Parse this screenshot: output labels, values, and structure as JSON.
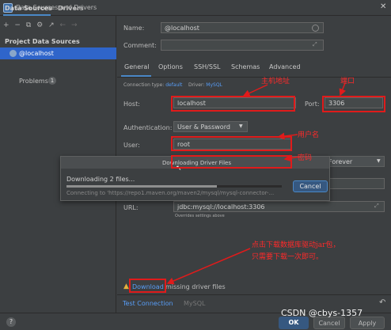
{
  "window": {
    "title": "Data Sources and Drivers",
    "close": "✕"
  },
  "left": {
    "tabs": [
      "Data Sources",
      "Drivers"
    ],
    "toolbar": {
      "add": "+",
      "remove": "−",
      "copy": "⧉",
      "settings": "⚙",
      "more": "↗",
      "back": "←",
      "forward": "→"
    },
    "section_header": "Project Data Sources",
    "items": [
      {
        "label": "@localhost",
        "selected": true
      }
    ],
    "problems": {
      "label": "Problems",
      "count": "1"
    }
  },
  "form": {
    "name_label": "Name:",
    "name_value": "@localhost",
    "comment_label": "Comment:",
    "comment_expand": "⤢",
    "tabs": [
      "General",
      "Options",
      "SSH/SSL",
      "Schemas",
      "Advanced"
    ],
    "active_tab": "General",
    "conn_type_label": "Connection type:",
    "conn_type_value": "default",
    "driver_label": "Driver:",
    "driver_value": "MySQL",
    "host_label": "Host:",
    "host_value": "localhost",
    "port_label": "Port:",
    "port_value": "3306",
    "auth_label": "Authentication:",
    "auth_value": "User & Password",
    "user_label": "User:",
    "user_value": "root",
    "save_value": "Forever",
    "url_label": "URL:",
    "url_value": "jdbc:mysql://localhost:3306",
    "url_note": "Overrides settings above",
    "missing_driver_prefix": "Download",
    "missing_driver_rest": "missing driver files",
    "test_connection": "Test Connection",
    "driver_footer": "MySQL",
    "undo_icon": "↶"
  },
  "modal": {
    "title": "Downloading Driver Files",
    "status": "Downloading 2 files...",
    "progress_fraction": 0.7,
    "url_text": "Connecting to 'https://repo1.maven.org/maven2/mysql/mysql-connector-...",
    "cancel": "Cancel"
  },
  "annotations": {
    "host": "主机地址",
    "port": "端口",
    "user": "用户名",
    "password": "密码",
    "download_line1": "点击下载数据库驱动jar包，",
    "download_line2": "只需要下载一次即可。"
  },
  "footer": {
    "help": "?",
    "ok": "OK",
    "cancel": "Cancel",
    "apply": "Apply"
  },
  "watermark": "CSDN @cbys-1357",
  "colors": {
    "accent": "#4a88c7",
    "selection": "#2f65ca",
    "link": "#589df6",
    "annotation": "#e01b1b",
    "background": "#3c3f41"
  }
}
